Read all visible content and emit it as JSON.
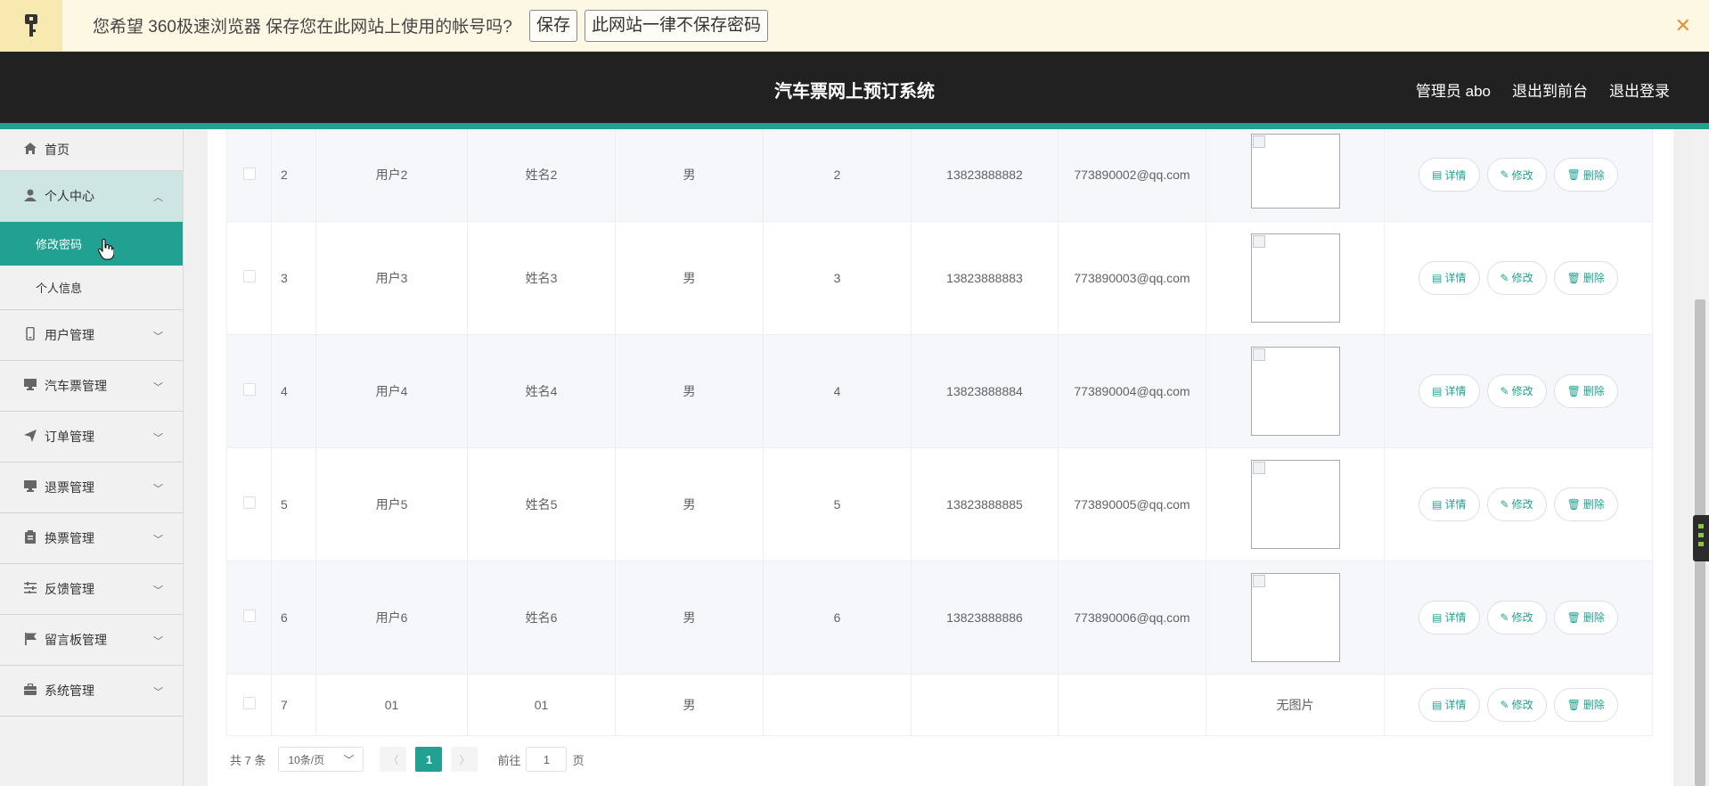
{
  "password_bar": {
    "message": "您希望 360极速浏览器 保存您在此网站上使用的帐号吗?",
    "save_label": "保存",
    "never_label": "此网站一律不保存密码",
    "close_label": "✕"
  },
  "header": {
    "title": "汽车票网上预订系统",
    "admin_label": "管理员 abo",
    "to_front_label": "退出到前台",
    "logout_label": "退出登录"
  },
  "sidebar": {
    "home": "首页",
    "personal_center": "个人中心",
    "sub_items": [
      "修改密码",
      "个人信息"
    ],
    "items": [
      "用户管理",
      "汽车票管理",
      "订单管理",
      "退票管理",
      "换票管理",
      "反馈管理",
      "留言板管理",
      "系统管理"
    ]
  },
  "table": {
    "rows": [
      {
        "index": "2",
        "account": "用户2",
        "name": "姓名2",
        "gender": "男",
        "age": "2",
        "phone": "13823888882",
        "email": "773890002@qq.com",
        "photo": ""
      },
      {
        "index": "3",
        "account": "用户3",
        "name": "姓名3",
        "gender": "男",
        "age": "3",
        "phone": "13823888883",
        "email": "773890003@qq.com",
        "photo": ""
      },
      {
        "index": "4",
        "account": "用户4",
        "name": "姓名4",
        "gender": "男",
        "age": "4",
        "phone": "13823888884",
        "email": "773890004@qq.com",
        "photo": ""
      },
      {
        "index": "5",
        "account": "用户5",
        "name": "姓名5",
        "gender": "男",
        "age": "5",
        "phone": "13823888885",
        "email": "773890005@qq.com",
        "photo": ""
      },
      {
        "index": "6",
        "account": "用户6",
        "name": "姓名6",
        "gender": "男",
        "age": "6",
        "phone": "13823888886",
        "email": "773890006@qq.com",
        "photo": ""
      },
      {
        "index": "7",
        "account": "01",
        "name": "01",
        "gender": "男",
        "age": "",
        "phone": "",
        "email": "",
        "photo": "无图片"
      }
    ],
    "actions": {
      "detail": "详情",
      "edit": "修改",
      "delete": "删除"
    }
  },
  "pagination": {
    "total": "共 7 条",
    "page_size": "10条/页",
    "current_page": "1",
    "goto_prefix": "前往",
    "goto_value": "1",
    "goto_suffix": "页"
  },
  "colors": {
    "accent": "#21a191",
    "header_bg": "#212121"
  }
}
